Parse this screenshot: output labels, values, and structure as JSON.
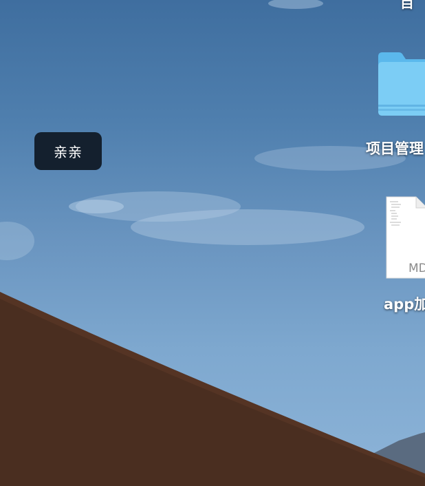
{
  "tooltip": {
    "text": "亲亲"
  },
  "desktop_icons": [
    {
      "label": "目",
      "type": "partial-item"
    },
    {
      "label": "项目管理",
      "type": "folder"
    },
    {
      "label": "app加",
      "type": "document",
      "extension": "MD"
    }
  ],
  "colors": {
    "sky_top": "#3f6e9f",
    "sky_bottom": "#8db4d8",
    "dune": "#4a2e20",
    "tooltip_bg": "#14202e",
    "folder": "#6cc4f2"
  }
}
